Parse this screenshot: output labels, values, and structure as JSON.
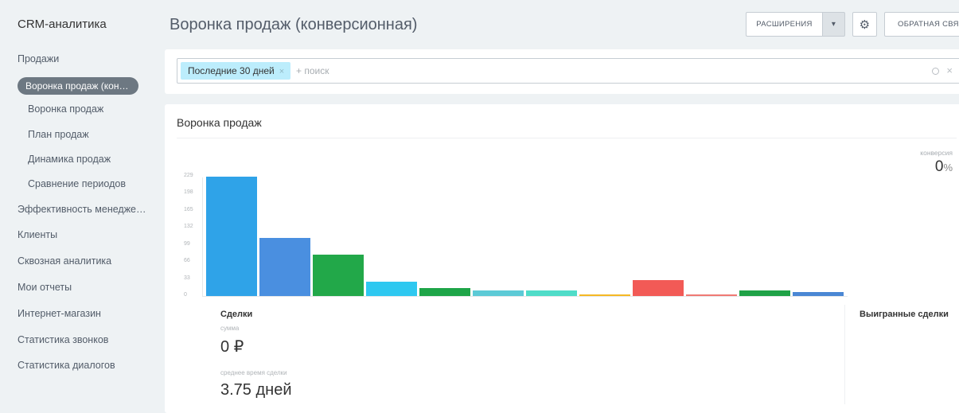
{
  "sidebar": {
    "title": "CRM-аналитика",
    "items": [
      {
        "label": "Продажи"
      },
      {
        "label": "Воронка продаж (кон…",
        "active": true
      },
      {
        "label": "Воронка продаж"
      },
      {
        "label": "План продаж"
      },
      {
        "label": "Динамика продаж"
      },
      {
        "label": "Сравнение периодов"
      },
      {
        "label": "Эффективность менедже…"
      },
      {
        "label": "Клиенты"
      },
      {
        "label": "Сквозная аналитика"
      },
      {
        "label": "Мои отчеты"
      },
      {
        "label": "Интернет-магазин"
      },
      {
        "label": "Статистика звонков"
      },
      {
        "label": "Статистика диалогов"
      }
    ]
  },
  "header": {
    "title": "Воронка продаж (конверсионная)",
    "extensions_label": "РАСШИРЕНИЯ",
    "dropdown_icon": "▾",
    "gear_icon": "⚙",
    "feedback_label": "ОБРАТНАЯ СВЯЗЬ"
  },
  "filter": {
    "chip_label": "Последние 30 дней",
    "chip_close": "×",
    "search_placeholder": "+ поиск",
    "search_icon": "⚲",
    "clear_icon": "×"
  },
  "card": {
    "title": "Воронка продаж",
    "conversion_label": "конверсия",
    "conversion_value": "0",
    "conversion_unit": "%",
    "deals_title": "Сделки",
    "sum_label": "сумма",
    "sum_value": "0 ₽",
    "avg_time_label": "среднее время сделки",
    "avg_time_value": "3.75 дней",
    "won_title": "Выигранные сделки"
  },
  "chart_data": {
    "type": "bar",
    "title": "Воронка продаж",
    "y_ticks": [
      "229",
      "198",
      "165",
      "132",
      "99",
      "66",
      "33",
      "0"
    ],
    "ylim": [
      0,
      229
    ],
    "values": [
      229,
      112,
      80,
      28,
      15,
      10,
      10,
      2,
      31,
      2,
      10,
      7
    ],
    "colors": [
      "#2fa3e8",
      "#4a8fe0",
      "#22a849",
      "#2ec8f0",
      "#1ea548",
      "#5ccad6",
      "#4fdcc8",
      "#f5b825",
      "#f25a56",
      "#f07a74",
      "#1fa247",
      "#4a87d4"
    ]
  }
}
